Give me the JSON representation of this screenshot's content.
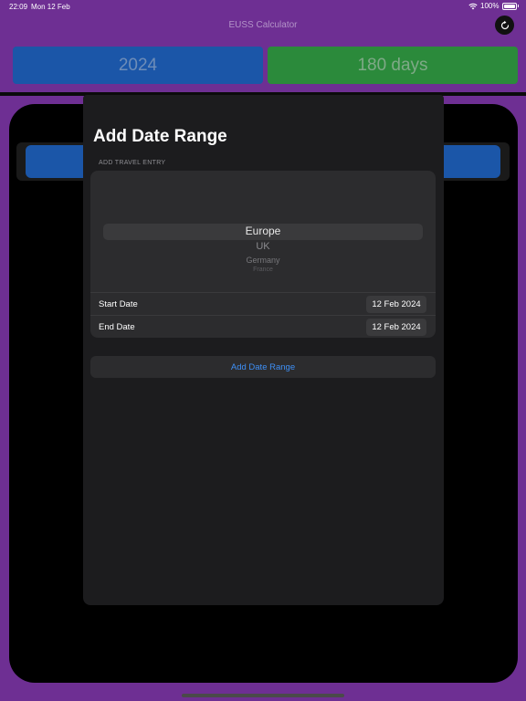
{
  "status_bar": {
    "time": "22:09",
    "date": "Mon 12 Feb",
    "battery": "100%"
  },
  "app": {
    "title": "EUSS Calculator"
  },
  "summary": {
    "year": "2024",
    "days": "180 days"
  },
  "modal": {
    "title": "Add Date Range",
    "section_header": "ADD TRAVEL ENTRY",
    "picker": {
      "selected": "Europe",
      "options": [
        "UK",
        "Germany",
        "France"
      ]
    },
    "start_label": "Start Date",
    "start_value": "12 Feb 2024",
    "end_label": "End Date",
    "end_value": "12 Feb 2024",
    "action_label": "Add Date Range"
  },
  "colors": {
    "background": "#6e2f93",
    "year_tile": "#1b56a8",
    "days_tile": "#2b8a3b",
    "accent": "#3e8ff5"
  },
  "icons": {
    "refresh": "refresh-icon",
    "wifi": "wifi-icon",
    "battery": "battery-icon"
  }
}
